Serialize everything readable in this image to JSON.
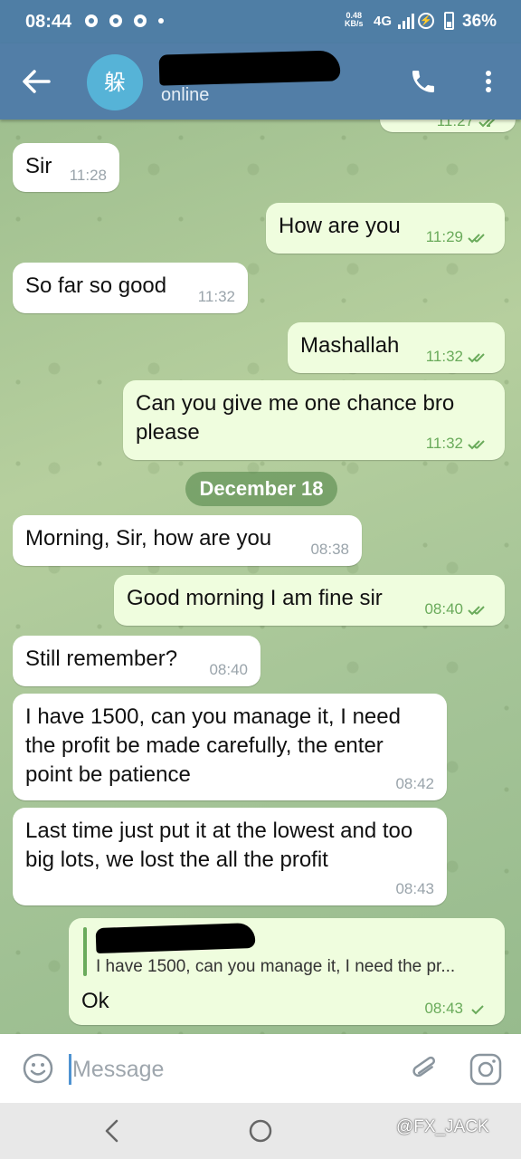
{
  "status_bar": {
    "time": "08:44",
    "net_speed_value": "0.48",
    "net_speed_unit": "KB/s",
    "network": "4G",
    "battery_percent": "36%"
  },
  "header": {
    "avatar_char": "躲",
    "status": "online"
  },
  "date_separator": "December 18",
  "messages": [
    {
      "direction": "out",
      "text": "",
      "time": "11:27",
      "read": true
    },
    {
      "direction": "in",
      "text": "Sir",
      "time": "11:28"
    },
    {
      "direction": "out",
      "text": "How are you",
      "time": "11:29",
      "read": true
    },
    {
      "direction": "in",
      "text": "So far so good",
      "time": "11:32"
    },
    {
      "direction": "out",
      "text": "Mashallah",
      "time": "11:32",
      "read": true
    },
    {
      "direction": "out",
      "text": "Can you give me one chance bro please",
      "time": "11:32",
      "read": true
    },
    {
      "direction": "in",
      "text": "Morning, Sir, how are you",
      "time": "08:38"
    },
    {
      "direction": "out",
      "text": "Good morning I am fine sir",
      "time": "08:40",
      "read": true
    },
    {
      "direction": "in",
      "text": "Still remember?",
      "time": "08:40"
    },
    {
      "direction": "in",
      "text": "I have 1500, can you manage it, I need the profit be made carefully, the enter point be patience",
      "time": "08:42"
    },
    {
      "direction": "in",
      "text": "Last time just put it at the lowest and too big lots, we lost the all the profit",
      "time": "08:43"
    },
    {
      "direction": "out",
      "reply_preview": "I have 1500, can you manage it, I need the pr...",
      "text": "Ok",
      "time": "08:43",
      "read": false
    }
  ],
  "input": {
    "placeholder": "Message"
  },
  "watermark": "@FX_JACK",
  "colors": {
    "header": "#527ea7",
    "incoming_bubble": "#ffffff",
    "outgoing_bubble": "#effdde",
    "tick_green": "#6aab5b"
  },
  "icons": {
    "back": "arrow-left",
    "call": "phone",
    "more": "vertical-dots",
    "emoji": "smiley",
    "attach": "paperclip",
    "camera": "instagram-camera"
  }
}
